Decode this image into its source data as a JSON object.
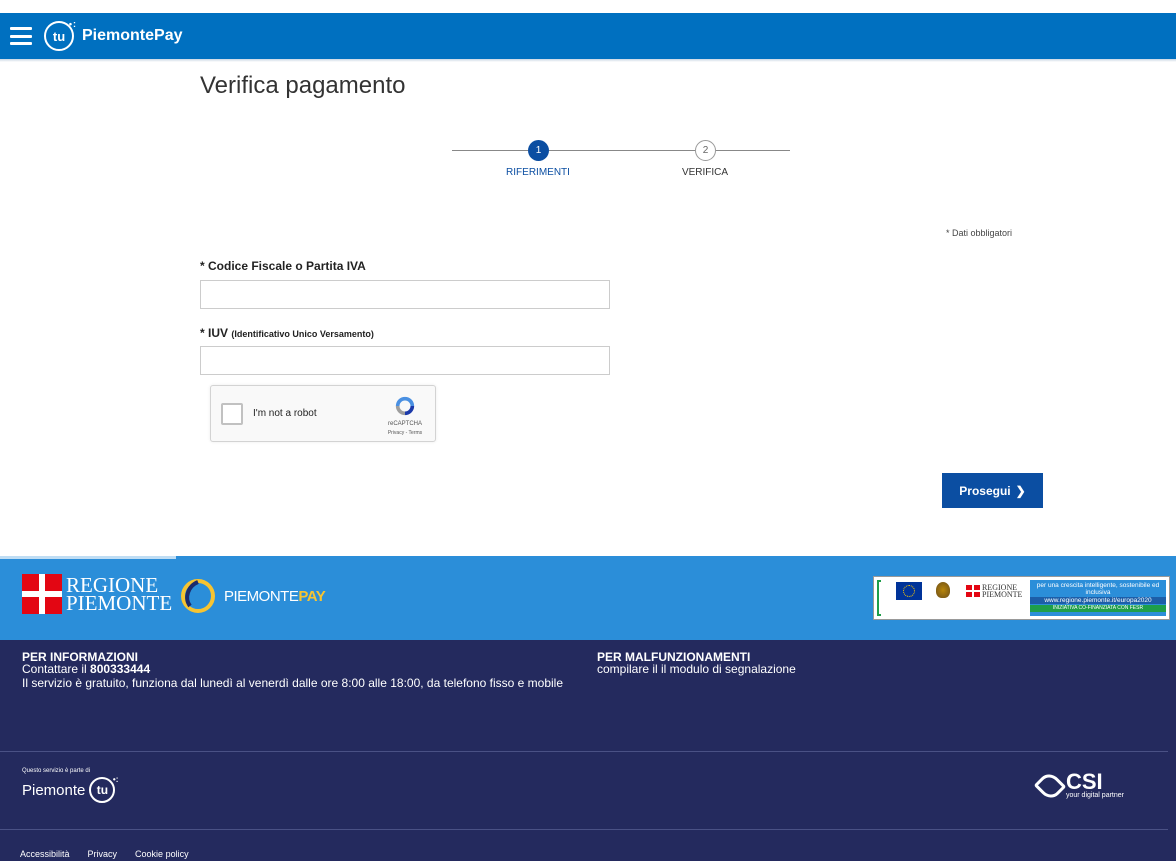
{
  "header": {
    "brand": "PiemontePay",
    "logo_text": "tu"
  },
  "main": {
    "title": "Verifica pagamento",
    "steps": [
      {
        "number": "1",
        "label": "RIFERIMENTI",
        "state": "active"
      },
      {
        "number": "2",
        "label": "VERIFICA",
        "state": "inactive"
      }
    ],
    "mandatory_note": "* Dati obbligatori",
    "fields": {
      "codice_fiscale": {
        "label": "* Codice Fiscale o Partita IVA",
        "value": "",
        "placeholder": ""
      },
      "iuv": {
        "label": "* IUV",
        "label_small": "(Identificativo Unico Versamento)",
        "value": "",
        "placeholder": ""
      }
    },
    "recaptcha": {
      "checkbox_label": "I'm not a robot",
      "brand": "reCAPTCHA",
      "links": "Privacy - Terms"
    },
    "next_button": "Prosegui"
  },
  "footer": {
    "regione": {
      "line1": "REGIONE",
      "line2": "PIEMONTE"
    },
    "piemontepay": {
      "part1": "PIEMONTE",
      "part2": "PAY"
    },
    "eu_banner": {
      "rp_line1": "REGIONE",
      "rp_line2": "PIEMONTE",
      "text": "per una crescita intelligente, sostenibile ed inclusiva",
      "url": "www.regione.piemonte.it/europa2020",
      "strip": "INIZIATIVA CO-FINANZIATA CON FESR"
    },
    "info": {
      "title": "PER INFORMAZIONI",
      "contact_prefix": "Contattare il ",
      "phone": "800333444",
      "hours": "Il servizio è gratuito, funziona dal lunedì al venerdì dalle ore 8:00 alle 18:00, da telefono fisso e mobile"
    },
    "malfunzionamenti": {
      "title": "PER MALFUNZIONAMENTI",
      "text": "compilare il il modulo di segnalazione"
    },
    "tu_footer": {
      "caption": "Questo servizio è parte di",
      "word": "Piemonte",
      "circle": "tu"
    },
    "csi": {
      "name": "CSI",
      "tagline": "your digital partner"
    },
    "links": [
      "Accessibilità",
      "Privacy",
      "Cookie policy"
    ]
  },
  "colors": {
    "header_blue": "#0070c0",
    "primary": "#0b4ea2",
    "footer_light": "#2b8ed9",
    "footer_dark": "#242a5e"
  }
}
